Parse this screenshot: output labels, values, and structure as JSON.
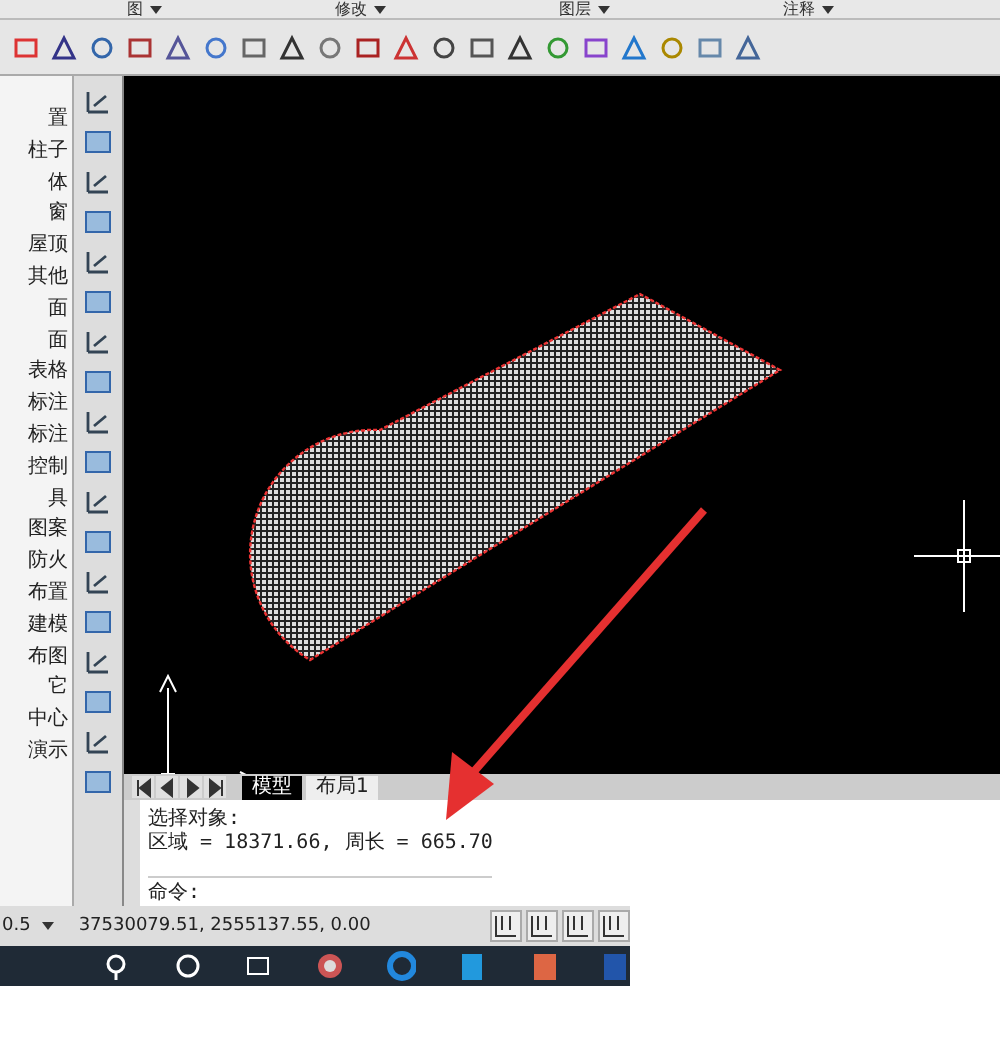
{
  "menu": [
    {
      "label": "图"
    },
    {
      "label": "修改"
    },
    {
      "label": "图层"
    },
    {
      "label": "注释"
    }
  ],
  "palette": {
    "items": [
      "置",
      "柱子",
      "体",
      "窗",
      "屋顶",
      "其他",
      "面",
      "面",
      "表格",
      "标注",
      "标注",
      "控制",
      "具",
      "图案",
      "防火",
      "布置",
      "建模",
      "布图",
      "它",
      "中心",
      "演示"
    ]
  },
  "layout_tabs": [
    {
      "label": "模型",
      "selected": true
    },
    {
      "label": "布局1",
      "selected": false
    }
  ],
  "command": {
    "lines": [
      "选择对象:",
      "区域 = 18371.66, 周长 = 665.70"
    ],
    "prompt": "命令:"
  },
  "status_bar": {
    "scale": "0.5",
    "coordinates": "37530079.51, 2555137.55, 0.00"
  }
}
